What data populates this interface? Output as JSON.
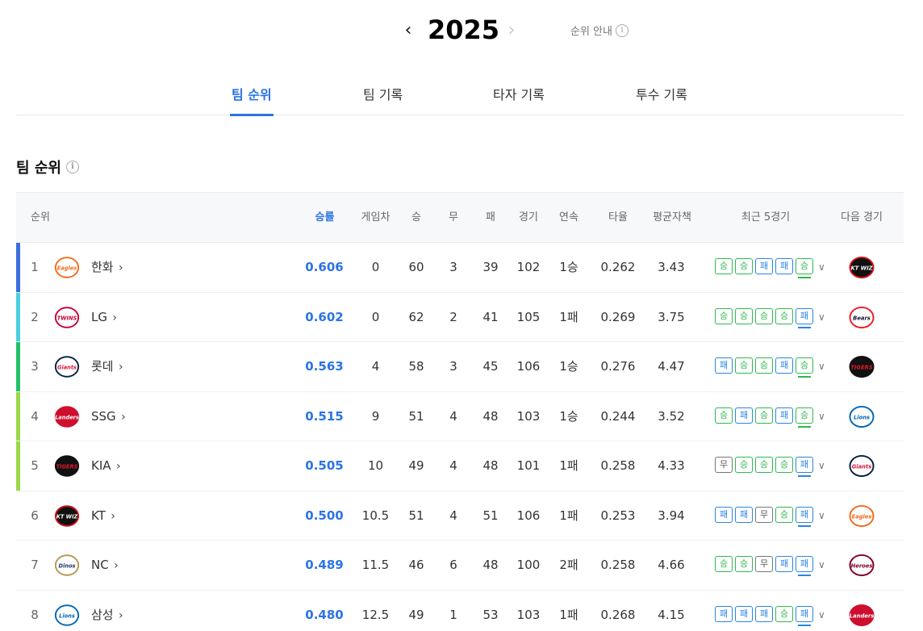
{
  "header": {
    "year": "2025",
    "prev_icon": "chevron-left-icon",
    "next_icon": "chevron-right-icon",
    "guide_label": "순위 안내",
    "guide_icon": "i"
  },
  "tabs": [
    {
      "label": "팀 순위",
      "active": true
    },
    {
      "label": "팀 기록",
      "active": false
    },
    {
      "label": "타자 기록",
      "active": false
    },
    {
      "label": "투수 기록",
      "active": false
    }
  ],
  "section": {
    "title": "팀 순위",
    "info_icon": "i"
  },
  "columns": {
    "rank": "순위",
    "pct": "승률",
    "gb": "게임차",
    "w": "승",
    "d": "무",
    "l": "패",
    "g": "경기",
    "streak": "연속",
    "avg": "타율",
    "era": "평균자책",
    "recent": "최근 5경기",
    "next": "다음 경기"
  },
  "colors": {
    "accent": "#2b74e4",
    "win": "#2fb84e",
    "loss": "#2b84e4",
    "tier_1": "#3b6fe0",
    "tier_2": "#49d0e0",
    "tier_3": "#23c06b",
    "tier_4": "#9bd84a"
  },
  "rows": [
    {
      "rank": "1",
      "team": "한화",
      "logo": "Eagles",
      "pct": "0.606",
      "gb": "0",
      "w": "60",
      "d": "3",
      "l": "39",
      "g": "102",
      "streak": "1승",
      "avg": "0.262",
      "era": "3.43",
      "recent": [
        "승",
        "승",
        "패",
        "패",
        "승"
      ],
      "next_logo": "KT WIZ",
      "bar": "#3b6fe0"
    },
    {
      "rank": "2",
      "team": "LG",
      "logo": "TWINS",
      "pct": "0.602",
      "gb": "0",
      "w": "62",
      "d": "2",
      "l": "41",
      "g": "105",
      "streak": "1패",
      "avg": "0.269",
      "era": "3.75",
      "recent": [
        "승",
        "승",
        "승",
        "승",
        "패"
      ],
      "next_logo": "Bears",
      "bar": "#49d0e0"
    },
    {
      "rank": "3",
      "team": "롯데",
      "logo": "Giants",
      "pct": "0.563",
      "gb": "4",
      "w": "58",
      "d": "3",
      "l": "45",
      "g": "106",
      "streak": "1승",
      "avg": "0.276",
      "era": "4.47",
      "recent": [
        "패",
        "승",
        "승",
        "패",
        "승"
      ],
      "next_logo": "TIGERS",
      "bar": "#23c06b"
    },
    {
      "rank": "4",
      "team": "SSG",
      "logo": "Landers",
      "pct": "0.515",
      "gb": "9",
      "w": "51",
      "d": "4",
      "l": "48",
      "g": "103",
      "streak": "1승",
      "avg": "0.244",
      "era": "3.52",
      "recent": [
        "승",
        "패",
        "승",
        "패",
        "승"
      ],
      "next_logo": "Lions",
      "bar": "#9bd84a"
    },
    {
      "rank": "5",
      "team": "KIA",
      "logo": "TIGERS",
      "pct": "0.505",
      "gb": "10",
      "w": "49",
      "d": "4",
      "l": "48",
      "g": "101",
      "streak": "1패",
      "avg": "0.258",
      "era": "4.33",
      "recent": [
        "무",
        "승",
        "승",
        "승",
        "패"
      ],
      "next_logo": "Giants",
      "bar": "#9bd84a"
    },
    {
      "rank": "6",
      "team": "KT",
      "logo": "KT WIZ",
      "pct": "0.500",
      "gb": "10.5",
      "w": "51",
      "d": "4",
      "l": "51",
      "g": "106",
      "streak": "1패",
      "avg": "0.253",
      "era": "3.94",
      "recent": [
        "패",
        "패",
        "무",
        "승",
        "패"
      ],
      "next_logo": "Eagles",
      "bar": ""
    },
    {
      "rank": "7",
      "team": "NC",
      "logo": "Dinos",
      "pct": "0.489",
      "gb": "11.5",
      "w": "46",
      "d": "6",
      "l": "48",
      "g": "100",
      "streak": "2패",
      "avg": "0.258",
      "era": "4.66",
      "recent": [
        "승",
        "승",
        "무",
        "패",
        "패"
      ],
      "next_logo": "Heroes",
      "bar": ""
    },
    {
      "rank": "8",
      "team": "삼성",
      "logo": "Lions",
      "pct": "0.480",
      "gb": "12.5",
      "w": "49",
      "d": "1",
      "l": "53",
      "g": "103",
      "streak": "1패",
      "avg": "0.268",
      "era": "4.15",
      "recent": [
        "패",
        "패",
        "패",
        "승",
        "패"
      ],
      "next_logo": "Landers",
      "bar": ""
    }
  ]
}
